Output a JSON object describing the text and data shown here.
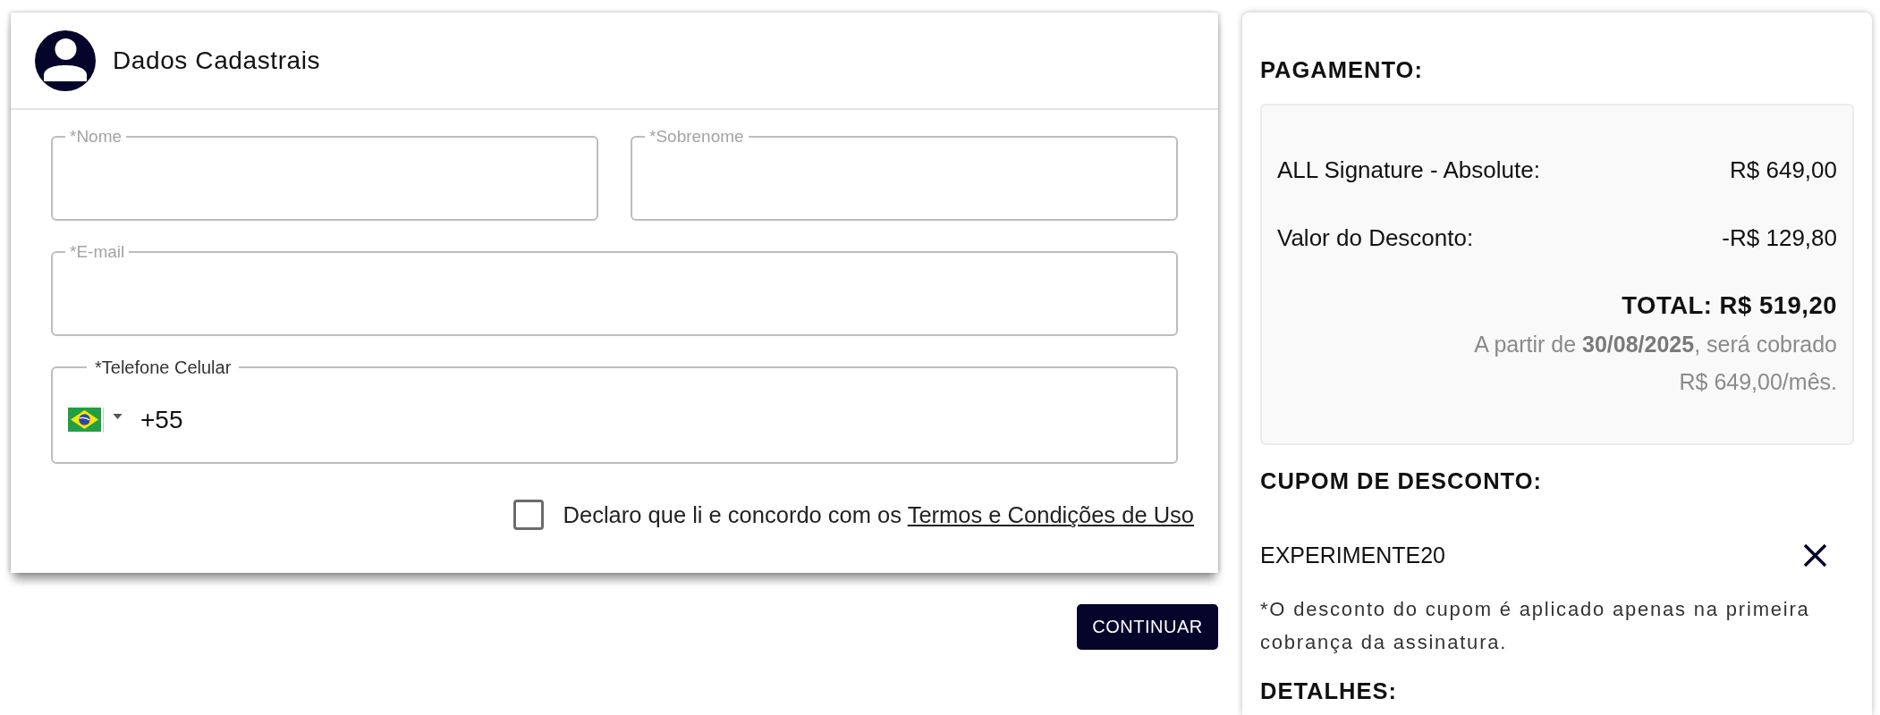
{
  "form": {
    "title": "Dados Cadastrais",
    "field_rows": [
      [
        {
          "kind": "text",
          "label": "*Nome"
        },
        {
          "kind": "text",
          "label": "*Sobrenome"
        }
      ],
      [
        {
          "kind": "text",
          "label": "*E-mail"
        }
      ],
      [
        {
          "kind": "phone",
          "label": "*Telefone Celular",
          "value": "+55"
        }
      ]
    ],
    "terms": {
      "checked": false,
      "text": "Declaro que li e concordo com os",
      "link": "Termos e Condições de Uso"
    }
  },
  "continue_button": "CONTINUAR",
  "payment": {
    "title": "PAGAMENTO:",
    "lines": [
      {
        "label": "ALL Signature - Absolute:",
        "value": "R$ 649,00"
      },
      {
        "label": "Valor do Desconto:",
        "value": "-R$ 129,80"
      }
    ],
    "total": "TOTAL: R$ 519,20",
    "note": "A partir de **30/08/2025**, será cobrado R$ 649,00/mês."
  },
  "coupon": {
    "title": "CUPOM DE DESCONTO:",
    "code": "EXPERIMENTE20",
    "note": "*O desconto do cupom é aplicado apenas na primeira cobrança da assinatura."
  },
  "details": {
    "title": "DETALHES:"
  }
}
